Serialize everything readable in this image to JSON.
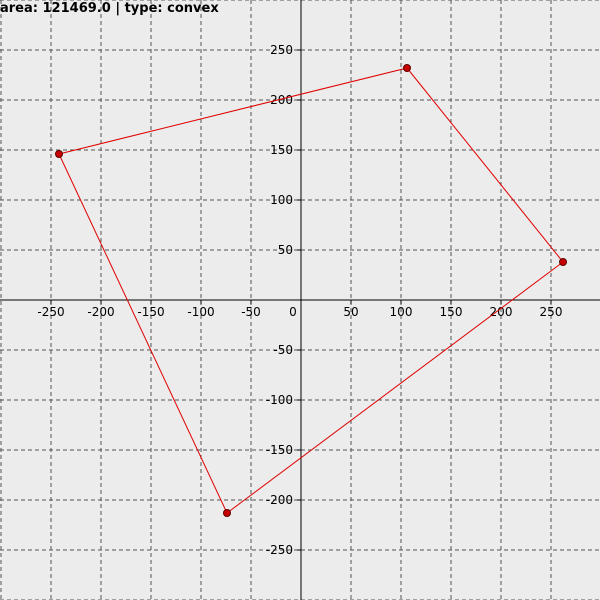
{
  "status": {
    "area_label": "area:",
    "area_value": "121469.0",
    "separator": "|",
    "type_label": "type:",
    "type_value": "convex"
  },
  "axes": {
    "x_range": [
      -300,
      300
    ],
    "y_range": [
      -300,
      300
    ],
    "tick_step": 50,
    "x_tick_labels": [
      "-250",
      "-200",
      "-150",
      "-100",
      "-50",
      "0",
      "50",
      "100",
      "150",
      "200",
      "250"
    ],
    "y_tick_labels": [
      "250",
      "200",
      "150",
      "100",
      "50",
      "-50",
      "-100",
      "-150",
      "-200",
      "-250"
    ],
    "grid": true
  },
  "polygon": {
    "color": "#e00000",
    "vertices": [
      {
        "x": -242,
        "y": 146
      },
      {
        "x": 106,
        "y": 232
      },
      {
        "x": 262,
        "y": 38
      },
      {
        "x": -74,
        "y": -213
      }
    ]
  }
}
